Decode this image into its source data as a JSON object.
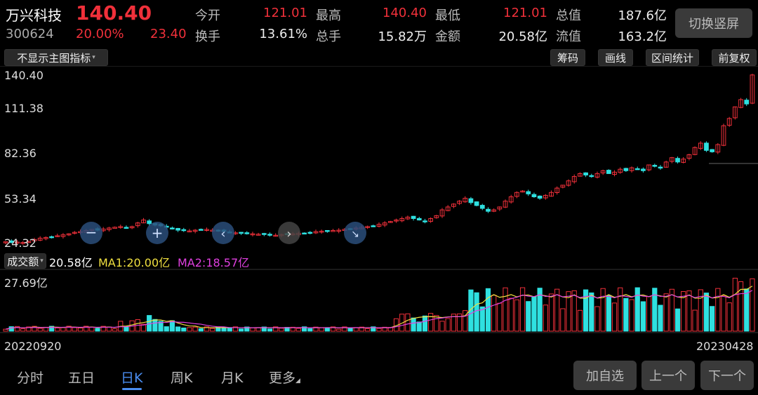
{
  "stock": {
    "name": "万兴科技",
    "code": "300624",
    "price": "140.40",
    "change_pct": "20.00%",
    "change": "23.40"
  },
  "stats": [
    {
      "label": "今开",
      "value": "121.01",
      "color": "red"
    },
    {
      "label": "最高",
      "value": "140.40",
      "color": "red"
    },
    {
      "label": "最低",
      "value": "121.01",
      "color": "red"
    },
    {
      "label": "总值",
      "value": "187.6亿",
      "color": "white"
    },
    {
      "label": "换手",
      "value": "13.61%",
      "color": "white"
    },
    {
      "label": "总手",
      "value": "15.82万",
      "color": "white"
    },
    {
      "label": "金额",
      "value": "20.58亿",
      "color": "white"
    },
    {
      "label": "流值",
      "value": "163.2亿",
      "color": "white"
    }
  ],
  "switch_label": "切换竖屏",
  "indicator_dropdown": "不显示主图指标",
  "tools": [
    "筹码",
    "画线",
    "区间统计",
    "前复权"
  ],
  "volume": {
    "dropdown": "成交额",
    "value": "20.58亿",
    "ma1": "MA1:20.00亿",
    "ma2": "MA2:18.57亿",
    "max_label": "27.69亿"
  },
  "dates": {
    "start": "20220920",
    "end": "20230428"
  },
  "tabs": [
    "分时",
    "五日",
    "日K",
    "周K",
    "月K",
    "更多"
  ],
  "active_tab": "日K",
  "actions": [
    "加自选",
    "上一个",
    "下一个"
  ],
  "colors": {
    "up": "#f0303a",
    "down": "#2fe0e0",
    "ma1": "#f0e040",
    "ma2": "#e040e0",
    "accent": "#4a8df0"
  },
  "chart_data": {
    "type": "candlestick",
    "y_ticks": [
      "140.40",
      "111.38",
      "82.36",
      "53.34",
      "24.32"
    ],
    "ylim": [
      24.32,
      140.4
    ],
    "volume_ylim": [
      0,
      27.69
    ],
    "closes": [
      25,
      24.5,
      24.8,
      24.5,
      25.2,
      26.5,
      27.5,
      28,
      28.5,
      29.2,
      29.8,
      30.5,
      31.5,
      32,
      32.8,
      33.5,
      33,
      33.8,
      34.5,
      35,
      35.5,
      34.8,
      35.5,
      38,
      40,
      37.5,
      36.5,
      36,
      35,
      33.8,
      33,
      32.8,
      32.5,
      33,
      33.2,
      33.5,
      33,
      32.5,
      32,
      31.5,
      31.2,
      30.8,
      30.5,
      30.5,
      30.2,
      30,
      29.8,
      29.5,
      30,
      30.2,
      30.5,
      30.8,
      31,
      31.5,
      32,
      32.3,
      32.5,
      32.8,
      33,
      33.5,
      34,
      34.5,
      35,
      35.5,
      36,
      37,
      38,
      39,
      40,
      41,
      42,
      41,
      40,
      39,
      41,
      43,
      47,
      49,
      51,
      53,
      55,
      52,
      50,
      48,
      46,
      47,
      49,
      53,
      56,
      59,
      60,
      58,
      56,
      55,
      57,
      59,
      62,
      64,
      67,
      70,
      72,
      71,
      70,
      72,
      74,
      72,
      73,
      75,
      74,
      76,
      75,
      74,
      78,
      77,
      76,
      80,
      83,
      80,
      82,
      85,
      90,
      93,
      88,
      87,
      92,
      105,
      110,
      118,
      123,
      120,
      140
    ]
  }
}
